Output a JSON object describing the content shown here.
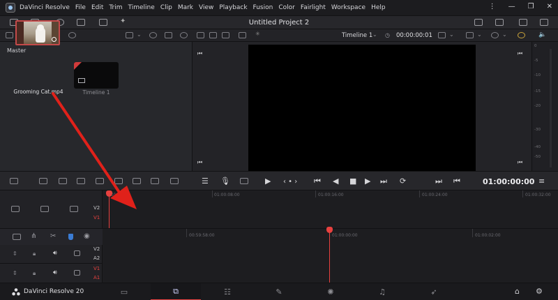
{
  "app": {
    "name": "DaVinci Resolve",
    "project_title": "Untitled Project 2",
    "brand_footer": "DaVinci Resolve 20"
  },
  "menu": [
    "File",
    "Edit",
    "Trim",
    "Timeline",
    "Clip",
    "Mark",
    "View",
    "Playback",
    "Fusion",
    "Color",
    "Fairlight",
    "Workspace",
    "Help"
  ],
  "window_controls": [
    "⋮",
    "—",
    "❐",
    "✕"
  ],
  "media_pool": {
    "folder": "Master",
    "clips": [
      {
        "name": "Grooming Cat.mp4",
        "selected": true
      },
      {
        "name": "Timeline 1",
        "selected": false
      }
    ]
  },
  "viewer": {
    "timeline_selector": "Timeline 1",
    "source_timecode": "00:00:00:01",
    "record_timecode": "01:00:00:00",
    "nav_dots": "‹ • ›"
  },
  "audio_meter": {
    "labels": [
      "0",
      "-5",
      "-10",
      "-15",
      "-20",
      "-30",
      "-40",
      "-50"
    ],
    "speaker_icon": "🔈"
  },
  "upper_timeline": {
    "ruler": [
      "01:00:08:00",
      "01:00:16:00",
      "01:00:24:00",
      "01:00:32:00"
    ],
    "tracks": [
      "V2",
      "V1"
    ],
    "playhead_partial": "01"
  },
  "lower_timeline": {
    "ruler": [
      "00:59:58:00",
      "01:00:00:00",
      "01:00:02:00"
    ],
    "video_tracks": [
      "V2",
      "A2"
    ],
    "audio_tracks": [
      "V1",
      "A1"
    ]
  },
  "colors": {
    "accent_red": "#e8413f",
    "annotation_arrow": "#e0211a",
    "panel_bg": "#27282c",
    "viewer_bg": "#000000"
  },
  "annotation": {
    "type": "arrow",
    "from": "Grooming Cat.mp4",
    "to": "V1 track",
    "color": "#e0211a"
  }
}
